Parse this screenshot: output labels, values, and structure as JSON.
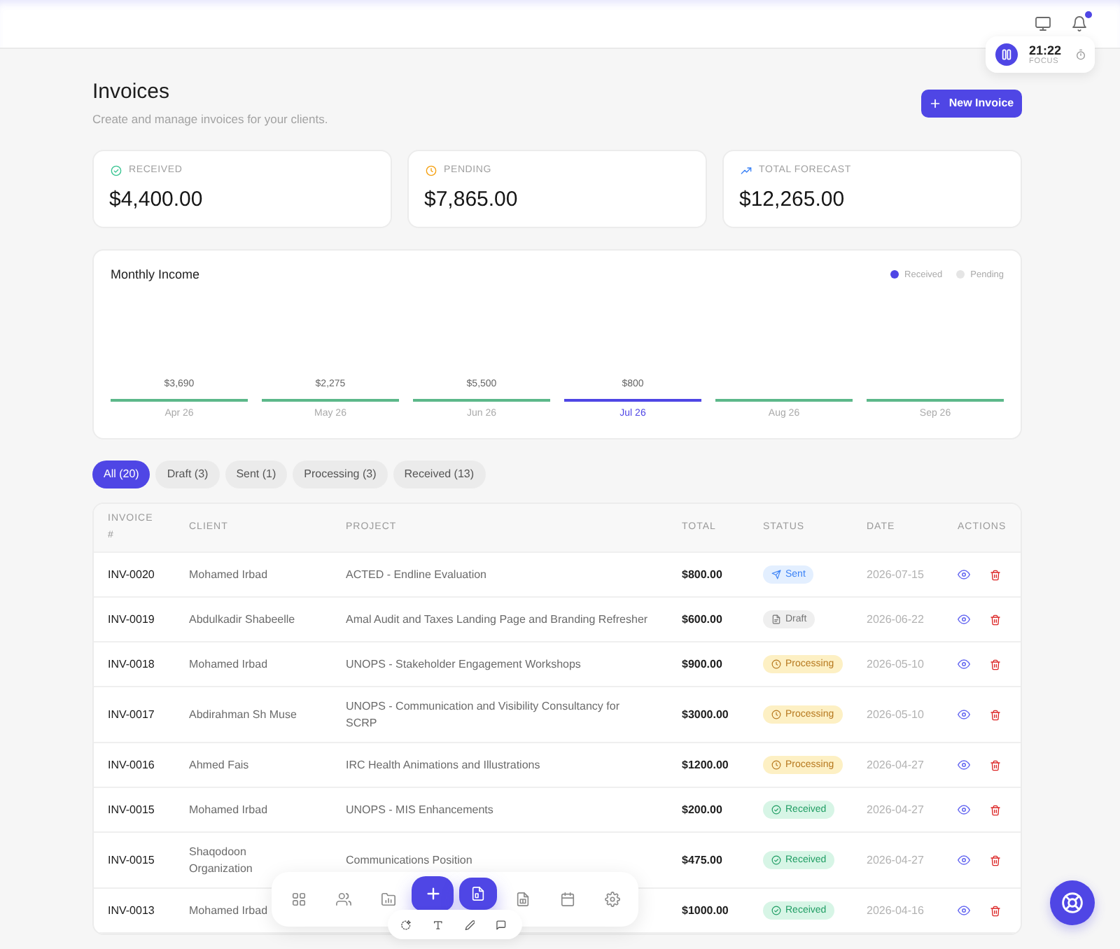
{
  "header": {
    "unread_notifications": true,
    "focus": {
      "time": "21:22",
      "label": "FOCUS"
    }
  },
  "page": {
    "title": "Invoices",
    "subtitle": "Create and manage invoices for your clients.",
    "new_button": "New Invoice"
  },
  "stats": [
    {
      "kind": "received",
      "label": "RECEIVED",
      "amount": "$4,400.00"
    },
    {
      "kind": "pending",
      "label": "PENDING",
      "amount": "$7,865.00"
    },
    {
      "kind": "forecast",
      "label": "TOTAL FORECAST",
      "amount": "$12,265.00"
    }
  ],
  "monthly_income": {
    "title": "Monthly Income",
    "legend": [
      {
        "label": "Received",
        "color": "#4f46e5"
      },
      {
        "label": "Pending",
        "color": "#e5e5e5"
      }
    ],
    "months": [
      {
        "label": "Apr 26",
        "amount": "$3,690",
        "selected": false
      },
      {
        "label": "May 26",
        "amount": "$2,275",
        "selected": false
      },
      {
        "label": "Jun 26",
        "amount": "$5,500",
        "selected": false
      },
      {
        "label": "Jul 26",
        "amount": "$800",
        "selected": true
      },
      {
        "label": "Aug 26",
        "selected": false
      },
      {
        "label": "Sep 26",
        "selected": false
      }
    ]
  },
  "filters": [
    {
      "label": "All (20)",
      "selected": true
    },
    {
      "label": "Draft (3)",
      "selected": false
    },
    {
      "label": "Sent (1)",
      "selected": false
    },
    {
      "label": "Processing (3)",
      "selected": false
    },
    {
      "label": "Received (13)",
      "selected": false
    }
  ],
  "table": {
    "columns": [
      "INVOICE #",
      "CLIENT",
      "PROJECT",
      "TOTAL",
      "STATUS",
      "DATE",
      "ACTIONS"
    ],
    "rows": [
      {
        "invoice": "INV-0020",
        "client": "Mohamed Irbad",
        "project": "ACTED - Endline Evaluation",
        "total": "$800.00",
        "status": {
          "kind": "sent",
          "label": "Sent"
        },
        "date": "2026-07-15"
      },
      {
        "invoice": "INV-0019",
        "client": "Abdulkadir Shabeelle",
        "project": "Amal Audit and Taxes Landing Page and Branding Refresher",
        "total": "$600.00",
        "status": {
          "kind": "draft",
          "label": "Draft"
        },
        "date": "2026-06-22"
      },
      {
        "invoice": "INV-0018",
        "client": "Mohamed Irbad",
        "project": "UNOPS - Stakeholder Engagement Workshops",
        "total": "$900.00",
        "status": {
          "kind": "processing",
          "label": "Processing"
        },
        "date": "2026-05-10"
      },
      {
        "invoice": "INV-0017",
        "client": "Abdirahman Sh Muse",
        "project": "UNOPS - Communication and Visibility Consultancy for SCRP",
        "total": "$3000.00",
        "status": {
          "kind": "processing",
          "label": "Processing"
        },
        "date": "2026-05-10"
      },
      {
        "invoice": "INV-0016",
        "client": "Ahmed Fais",
        "project": "IRC Health Animations and Illustrations",
        "total": "$1200.00",
        "status": {
          "kind": "processing",
          "label": "Processing"
        },
        "date": "2026-04-27"
      },
      {
        "invoice": "INV-0015",
        "client": "Mohamed Irbad",
        "project": "UNOPS - MIS Enhancements",
        "total": "$200.00",
        "status": {
          "kind": "received",
          "label": "Received"
        },
        "date": "2026-04-27"
      },
      {
        "invoice": "INV-0015",
        "client": "Shaqodoon Organization",
        "project": "Communications Position",
        "total": "$475.00",
        "status": {
          "kind": "received",
          "label": "Received"
        },
        "date": "2026-04-27"
      },
      {
        "invoice": "INV-0013",
        "client": "Mohamed Irbad",
        "total": "$1000.00",
        "status": {
          "kind": "received",
          "label": "Received"
        },
        "date": "2026-04-16"
      }
    ]
  },
  "dock": {
    "items": [
      {
        "selected": false
      },
      {
        "selected": false
      },
      {
        "selected": false
      },
      {
        "selected": true
      },
      {
        "selected": false
      },
      {
        "selected": false
      },
      {
        "selected": false
      }
    ]
  }
}
